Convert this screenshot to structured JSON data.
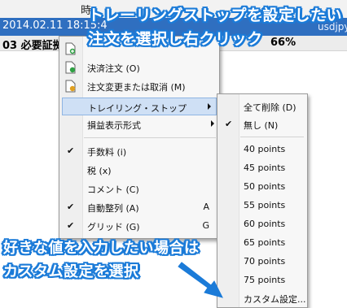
{
  "background": {
    "header_text": "時",
    "row_date": "2014.02.11 18:15:4",
    "row_symbol": "usdjpy",
    "row_label": "03  必要証拠金",
    "row_percent": "66%"
  },
  "annotation": {
    "top_line1": "トレーリングストップを設定したい",
    "top_line2": "注文を選択し右クリック",
    "bottom_line1": "好きな値を入力したい場合は",
    "bottom_line2": "カスタム設定を選択",
    "accent_color": "#1b7bd8"
  },
  "context_menu": {
    "items": [
      {
        "label": "",
        "icon": "new-order-icon"
      },
      {
        "label": "決済注文 (O)",
        "icon": "close-order-icon"
      },
      {
        "label": "注文変更または取消 (M)",
        "icon": "modify-order-icon"
      },
      {
        "label": "トレイリング・ストップ",
        "submenu": true,
        "highlighted": true
      },
      {
        "label": "損益表示形式",
        "submenu": true
      },
      {
        "label": "手数料 (i)",
        "checked": true
      },
      {
        "label": "税 (x)"
      },
      {
        "label": "コメント (C)"
      },
      {
        "label": "自動整列 (A)",
        "accel": "A",
        "checked": true
      },
      {
        "label": "グリッド (G)",
        "accel": "G",
        "checked": true
      }
    ]
  },
  "submenu": {
    "items": [
      {
        "label": "全て削除 (D)"
      },
      {
        "label": "無し (N)",
        "checked": true
      },
      {
        "label": "40 points"
      },
      {
        "label": "45 points"
      },
      {
        "label": "50 points"
      },
      {
        "label": "55 points"
      },
      {
        "label": "60 points"
      },
      {
        "label": "65 points"
      },
      {
        "label": "70 points"
      },
      {
        "label": "75 points"
      },
      {
        "label": "カスタム設定..."
      }
    ]
  }
}
